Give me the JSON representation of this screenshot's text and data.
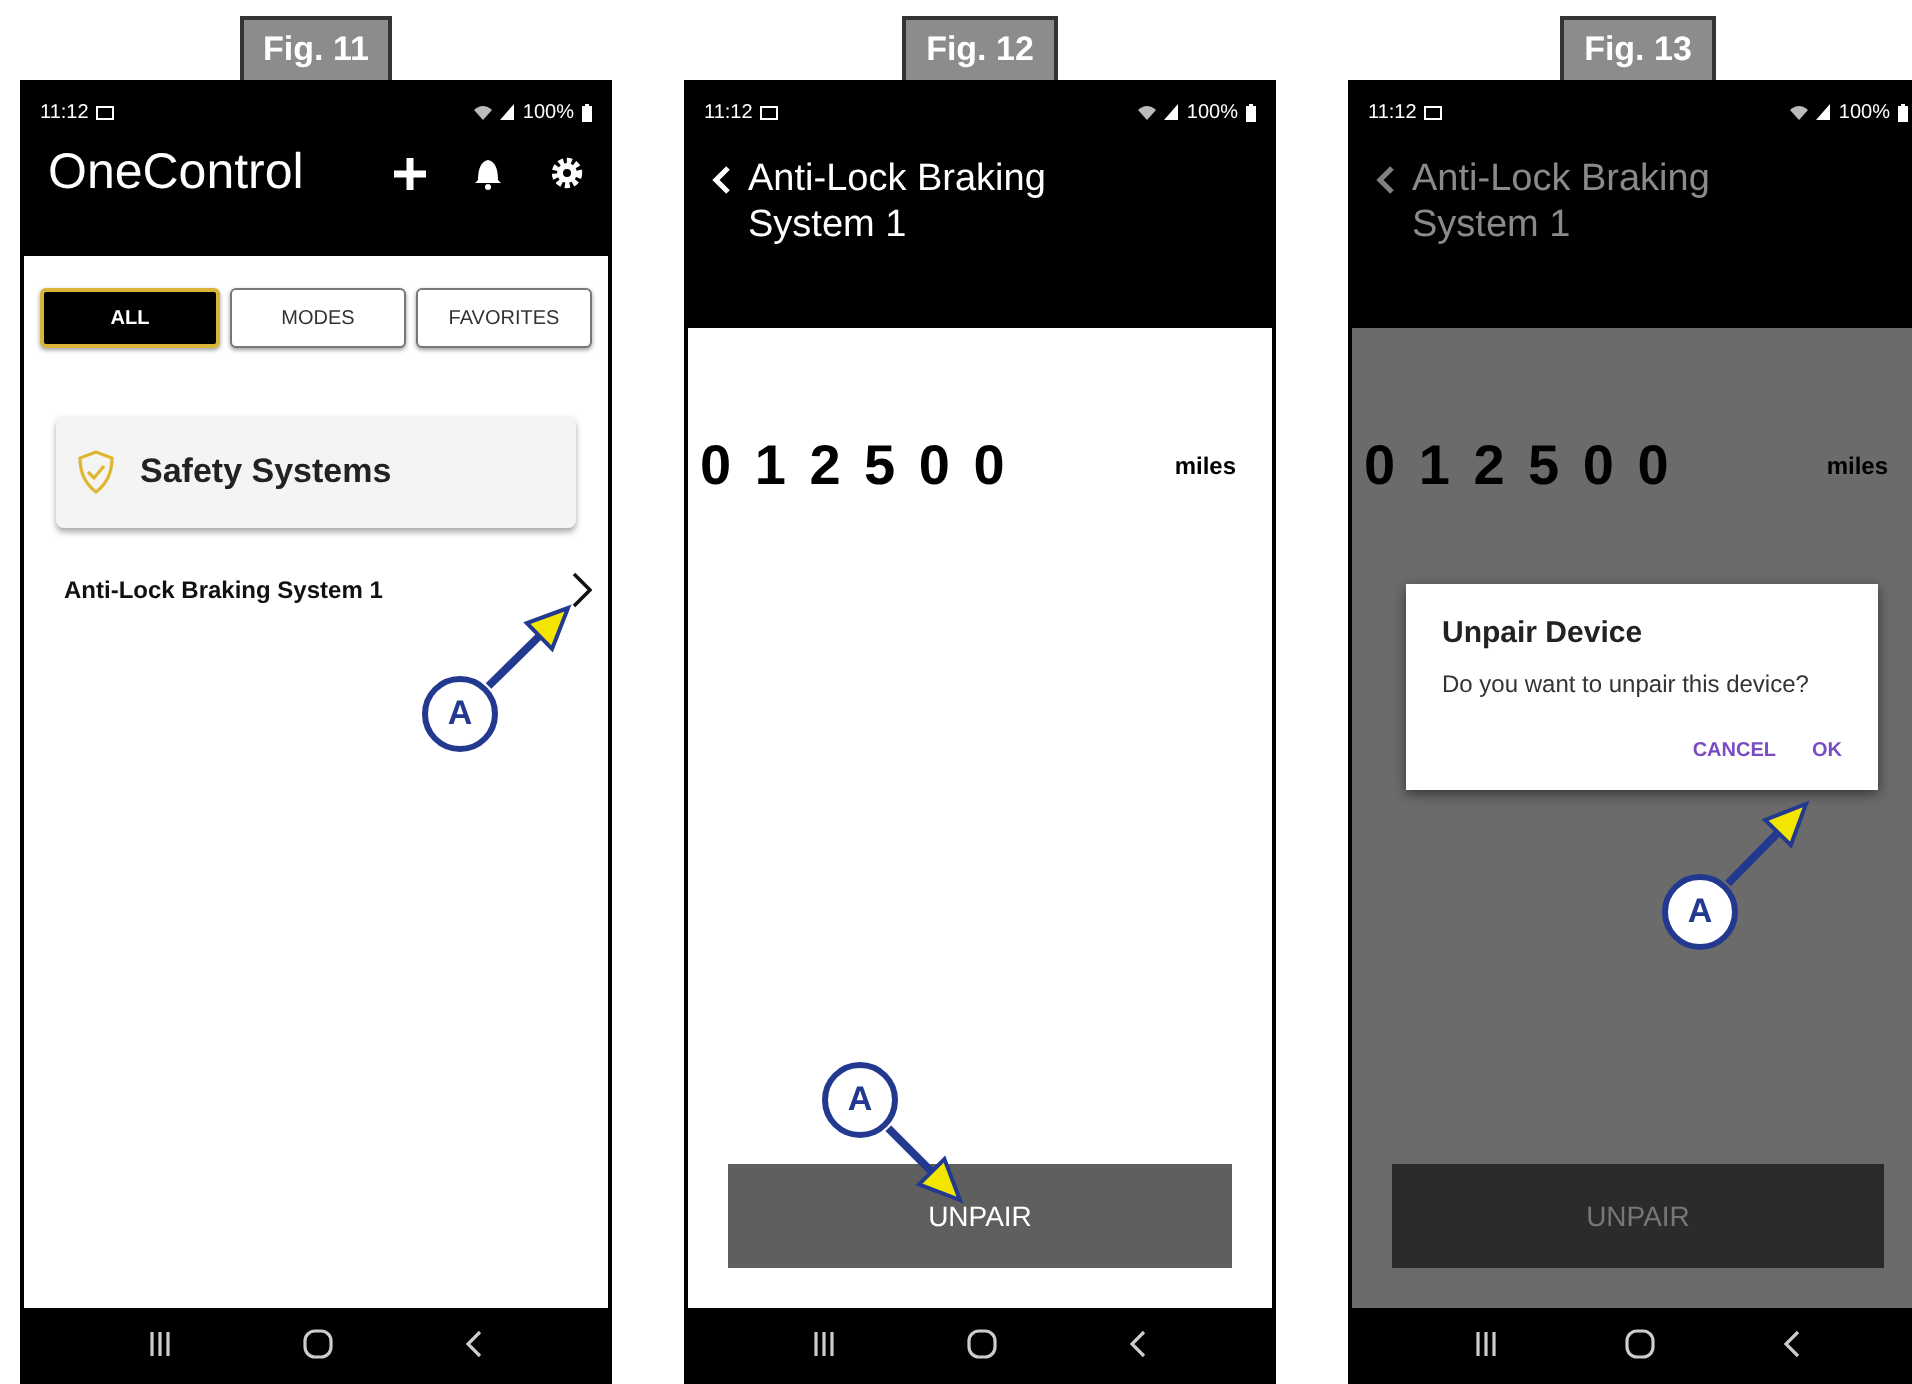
{
  "figures": [
    {
      "label": "Fig. 11",
      "kind": "home",
      "dimmed": false,
      "status_bar": {
        "time": "11:12",
        "battery": "100%"
      },
      "title": "OneControl",
      "tabs": [
        {
          "label": "ALL",
          "selected": true
        },
        {
          "label": "MODES",
          "selected": false
        },
        {
          "label": "FAVORITES",
          "selected": false
        }
      ],
      "category": "Safety Systems",
      "items": [
        {
          "label": "Anti-Lock Braking System 1"
        }
      ],
      "callout": "A"
    },
    {
      "label": "Fig. 12",
      "kind": "detail",
      "dimmed": false,
      "status_bar": {
        "time": "11:12",
        "battery": "100%"
      },
      "title": "Anti-Lock Braking System 1",
      "odometer": "0 1 2 5 0 0",
      "unit": "miles",
      "button": "UNPAIR",
      "callout": "A"
    },
    {
      "label": "Fig. 13",
      "kind": "detail",
      "dimmed": true,
      "status_bar": {
        "time": "11:12",
        "battery": "100%"
      },
      "title": "Anti-Lock Braking System 1",
      "odometer": "0 1 2 5 0 0",
      "unit": "miles",
      "button": "UNPAIR",
      "dialog": {
        "title": "Unpair Device",
        "message": "Do you want to unpair this device?",
        "actions": [
          "CANCEL",
          "OK"
        ]
      },
      "callout": "A"
    }
  ]
}
